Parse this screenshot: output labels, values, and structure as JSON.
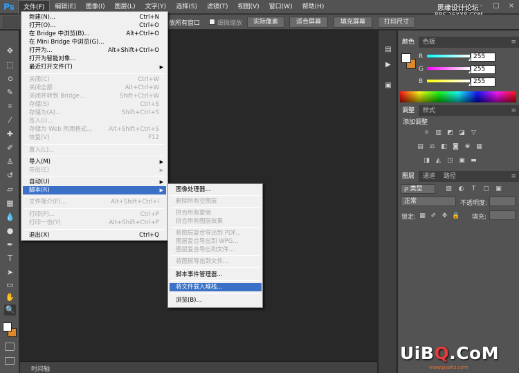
{
  "app": {
    "logo": "Ps"
  },
  "menubar": {
    "items": [
      {
        "label": "文件(F)"
      },
      {
        "label": "编辑(E)"
      },
      {
        "label": "图像(I)"
      },
      {
        "label": "图层(L)"
      },
      {
        "label": "文字(Y)"
      },
      {
        "label": "选择(S)"
      },
      {
        "label": "滤镜(T)"
      },
      {
        "label": "视图(V)"
      },
      {
        "label": "窗口(W)"
      },
      {
        "label": "帮助(H)"
      }
    ],
    "watermark": "思缘设计论坛",
    "watermark_sub": "BBS.16XX8.COM",
    "window_controls": [
      "–",
      "□",
      "×"
    ]
  },
  "options_bar": {
    "partial_label": "放所有窗口",
    "scrubby_zoom": "细微缩放",
    "actual_pixels": "实际像素",
    "fit_screen": "适合屏幕",
    "fill_screen": "填充屏幕",
    "print_size": "打印尺寸"
  },
  "file_menu": {
    "items": [
      {
        "label": "新建(N)...",
        "shortcut": "Ctrl+N",
        "disabled": false
      },
      {
        "label": "打开(O)...",
        "shortcut": "Ctrl+O",
        "disabled": false
      },
      {
        "label": "在 Bridge 中浏览(B)...",
        "shortcut": "Alt+Ctrl+O",
        "disabled": false
      },
      {
        "label": "在 Mini Bridge 中浏览(G)...",
        "shortcut": "",
        "disabled": false
      },
      {
        "label": "打开为...",
        "shortcut": "Alt+Shift+Ctrl+O",
        "disabled": false
      },
      {
        "label": "打开为智能对象...",
        "shortcut": "",
        "disabled": false
      },
      {
        "label": "最近打开文件(T)",
        "shortcut": "",
        "disabled": false,
        "submenu": true
      },
      {
        "label": "关闭(C)",
        "shortcut": "Ctrl+W",
        "disabled": true
      },
      {
        "label": "关闭全部",
        "shortcut": "Alt+Ctrl+W",
        "disabled": true
      },
      {
        "label": "关闭并转到 Bridge...",
        "shortcut": "Shift+Ctrl+W",
        "disabled": true
      },
      {
        "label": "存储(S)",
        "shortcut": "Ctrl+S",
        "disabled": true
      },
      {
        "label": "存储为(A)...",
        "shortcut": "Shift+Ctrl+S",
        "disabled": true
      },
      {
        "label": "签入(I)...",
        "shortcut": "",
        "disabled": true
      },
      {
        "label": "存储为 Web 所用格式...",
        "shortcut": "Alt+Shift+Ctrl+S",
        "disabled": true
      },
      {
        "label": "恢复(V)",
        "shortcut": "F12",
        "disabled": true
      },
      {
        "label": "置入(L)...",
        "shortcut": "",
        "disabled": true
      },
      {
        "label": "导入(M)",
        "shortcut": "",
        "disabled": false,
        "submenu": true
      },
      {
        "label": "导出(E)",
        "shortcut": "",
        "disabled": true,
        "submenu": true
      },
      {
        "label": "自动(U)",
        "shortcut": "",
        "disabled": false,
        "submenu": true
      },
      {
        "label": "脚本(R)",
        "shortcut": "",
        "disabled": false,
        "submenu": true,
        "highlighted": true
      },
      {
        "label": "文件简介(F)...",
        "shortcut": "Alt+Shift+Ctrl+I",
        "disabled": true
      },
      {
        "label": "打印(P)...",
        "shortcut": "Ctrl+P",
        "disabled": true
      },
      {
        "label": "打印一份(Y)",
        "shortcut": "Alt+Shift+Ctrl+P",
        "disabled": true
      },
      {
        "label": "退出(X)",
        "shortcut": "Ctrl+Q",
        "disabled": false
      }
    ]
  },
  "scripts_submenu": {
    "items": [
      {
        "label": "图像处理器...",
        "disabled": false
      },
      {
        "label": "删除所有空图层",
        "disabled": true
      },
      {
        "label": "拼合所有蒙版",
        "disabled": true
      },
      {
        "label": "拼合所有图层效果",
        "disabled": true
      },
      {
        "label": "将图层复合导出到 PDF...",
        "disabled": true
      },
      {
        "label": "图层复合导出到 WPG...",
        "disabled": true
      },
      {
        "label": "图层复合导出到文件...",
        "disabled": true
      },
      {
        "label": "将图层导出到文件...",
        "disabled": true
      },
      {
        "label": "脚本事件管理器...",
        "disabled": false
      },
      {
        "label": "将文件载入堆栈...",
        "disabled": false,
        "highlighted": true
      },
      {
        "label": "浏览(B)...",
        "disabled": false
      }
    ]
  },
  "color_panel": {
    "tabs": [
      "颜色",
      "色板"
    ],
    "r_label": "R",
    "g_label": "G",
    "b_label": "B",
    "r_value": "255",
    "g_value": "255",
    "b_value": "255",
    "fg_color": "#ffffff",
    "bg_color": "#e0892a"
  },
  "adjustments_panel": {
    "tabs": [
      "调整",
      "样式"
    ],
    "title": "添加调整"
  },
  "layers_panel": {
    "tabs": [
      "图层",
      "通道",
      "路径"
    ],
    "filter_kind": "类型",
    "blend_mode": "正常",
    "opacity_label": "不透明度:",
    "lock_label": "锁定:",
    "fill_label": "填充:"
  },
  "timeline": {
    "label": "时间轴"
  },
  "watermark_bottom": {
    "part1": "UiB",
    "part2": "Q",
    "part3": ".CoM",
    "sub": "www.psahz.com"
  }
}
